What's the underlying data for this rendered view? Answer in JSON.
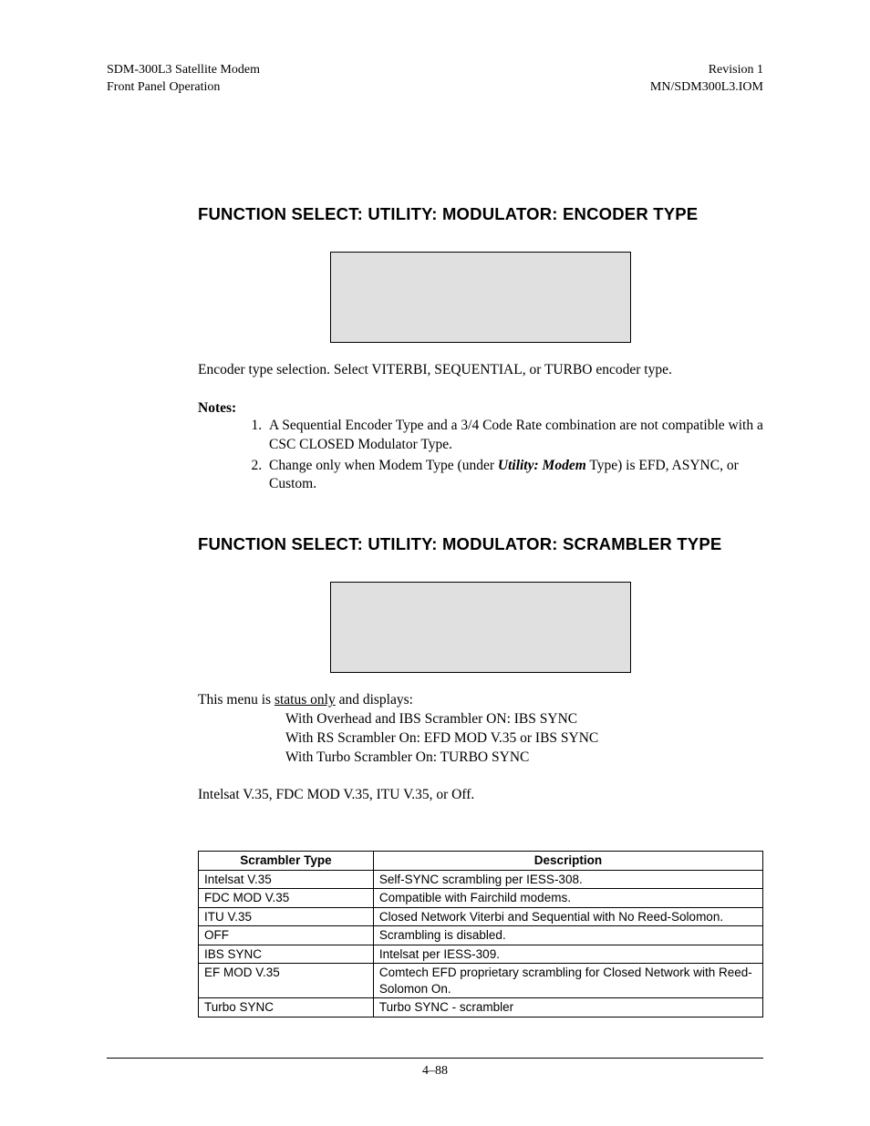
{
  "header": {
    "left1": "SDM-300L3 Satellite Modem",
    "left2": "Front Panel Operation",
    "right1": "Revision 1",
    "right2": "MN/SDM300L3.IOM"
  },
  "section1": {
    "heading": "FUNCTION SELECT: UTILITY: MODULATOR: ENCODER TYPE",
    "body": "Encoder type selection. Select VITERBI, SEQUENTIAL, or TURBO encoder type.",
    "notesLabel": "Notes:",
    "note1a": "A Sequential Encoder Type and a 3/4 Code Rate combination are not compatible with a CSC CLOSED Modulator Type.",
    "note2a": "Change only when Modem Type (under ",
    "note2b": "Utility: Modem",
    "note2c": " Type) is EFD, ASYNC, or Custom."
  },
  "section2": {
    "heading": "FUNCTION SELECT: UTILITY: MODULATOR: SCRAMBLER TYPE",
    "bodyA": "This menu is ",
    "bodyB": "status only",
    "bodyC": " and displays:",
    "line1": "With Overhead and IBS Scrambler ON: IBS SYNC",
    "line2": "With RS Scrambler On: EFD MOD V.35 or IBS SYNC",
    "line3": "With Turbo Scrambler On: TURBO SYNC",
    "body2": "Intelsat V.35, FDC MOD V.35, ITU V.35, or Off."
  },
  "table": {
    "h1": "Scrambler Type",
    "h2": "Description",
    "rows": [
      {
        "c1": "Intelsat V.35",
        "c2": "Self-SYNC scrambling per IESS-308."
      },
      {
        "c1": "FDC MOD V.35",
        "c2": "Compatible with Fairchild modems."
      },
      {
        "c1": "ITU V.35",
        "c2": "Closed Network Viterbi and Sequential with No Reed-Solomon."
      },
      {
        "c1": "OFF",
        "c2": "Scrambling is disabled."
      },
      {
        "c1": "IBS SYNC",
        "c2": "Intelsat per IESS-309."
      },
      {
        "c1": "EF MOD V.35",
        "c2": "Comtech EFD proprietary scrambling for Closed Network with Reed-Solomon On."
      },
      {
        "c1": "Turbo SYNC",
        "c2": "Turbo SYNC - scrambler"
      }
    ]
  },
  "footer": {
    "page": "4–88"
  }
}
